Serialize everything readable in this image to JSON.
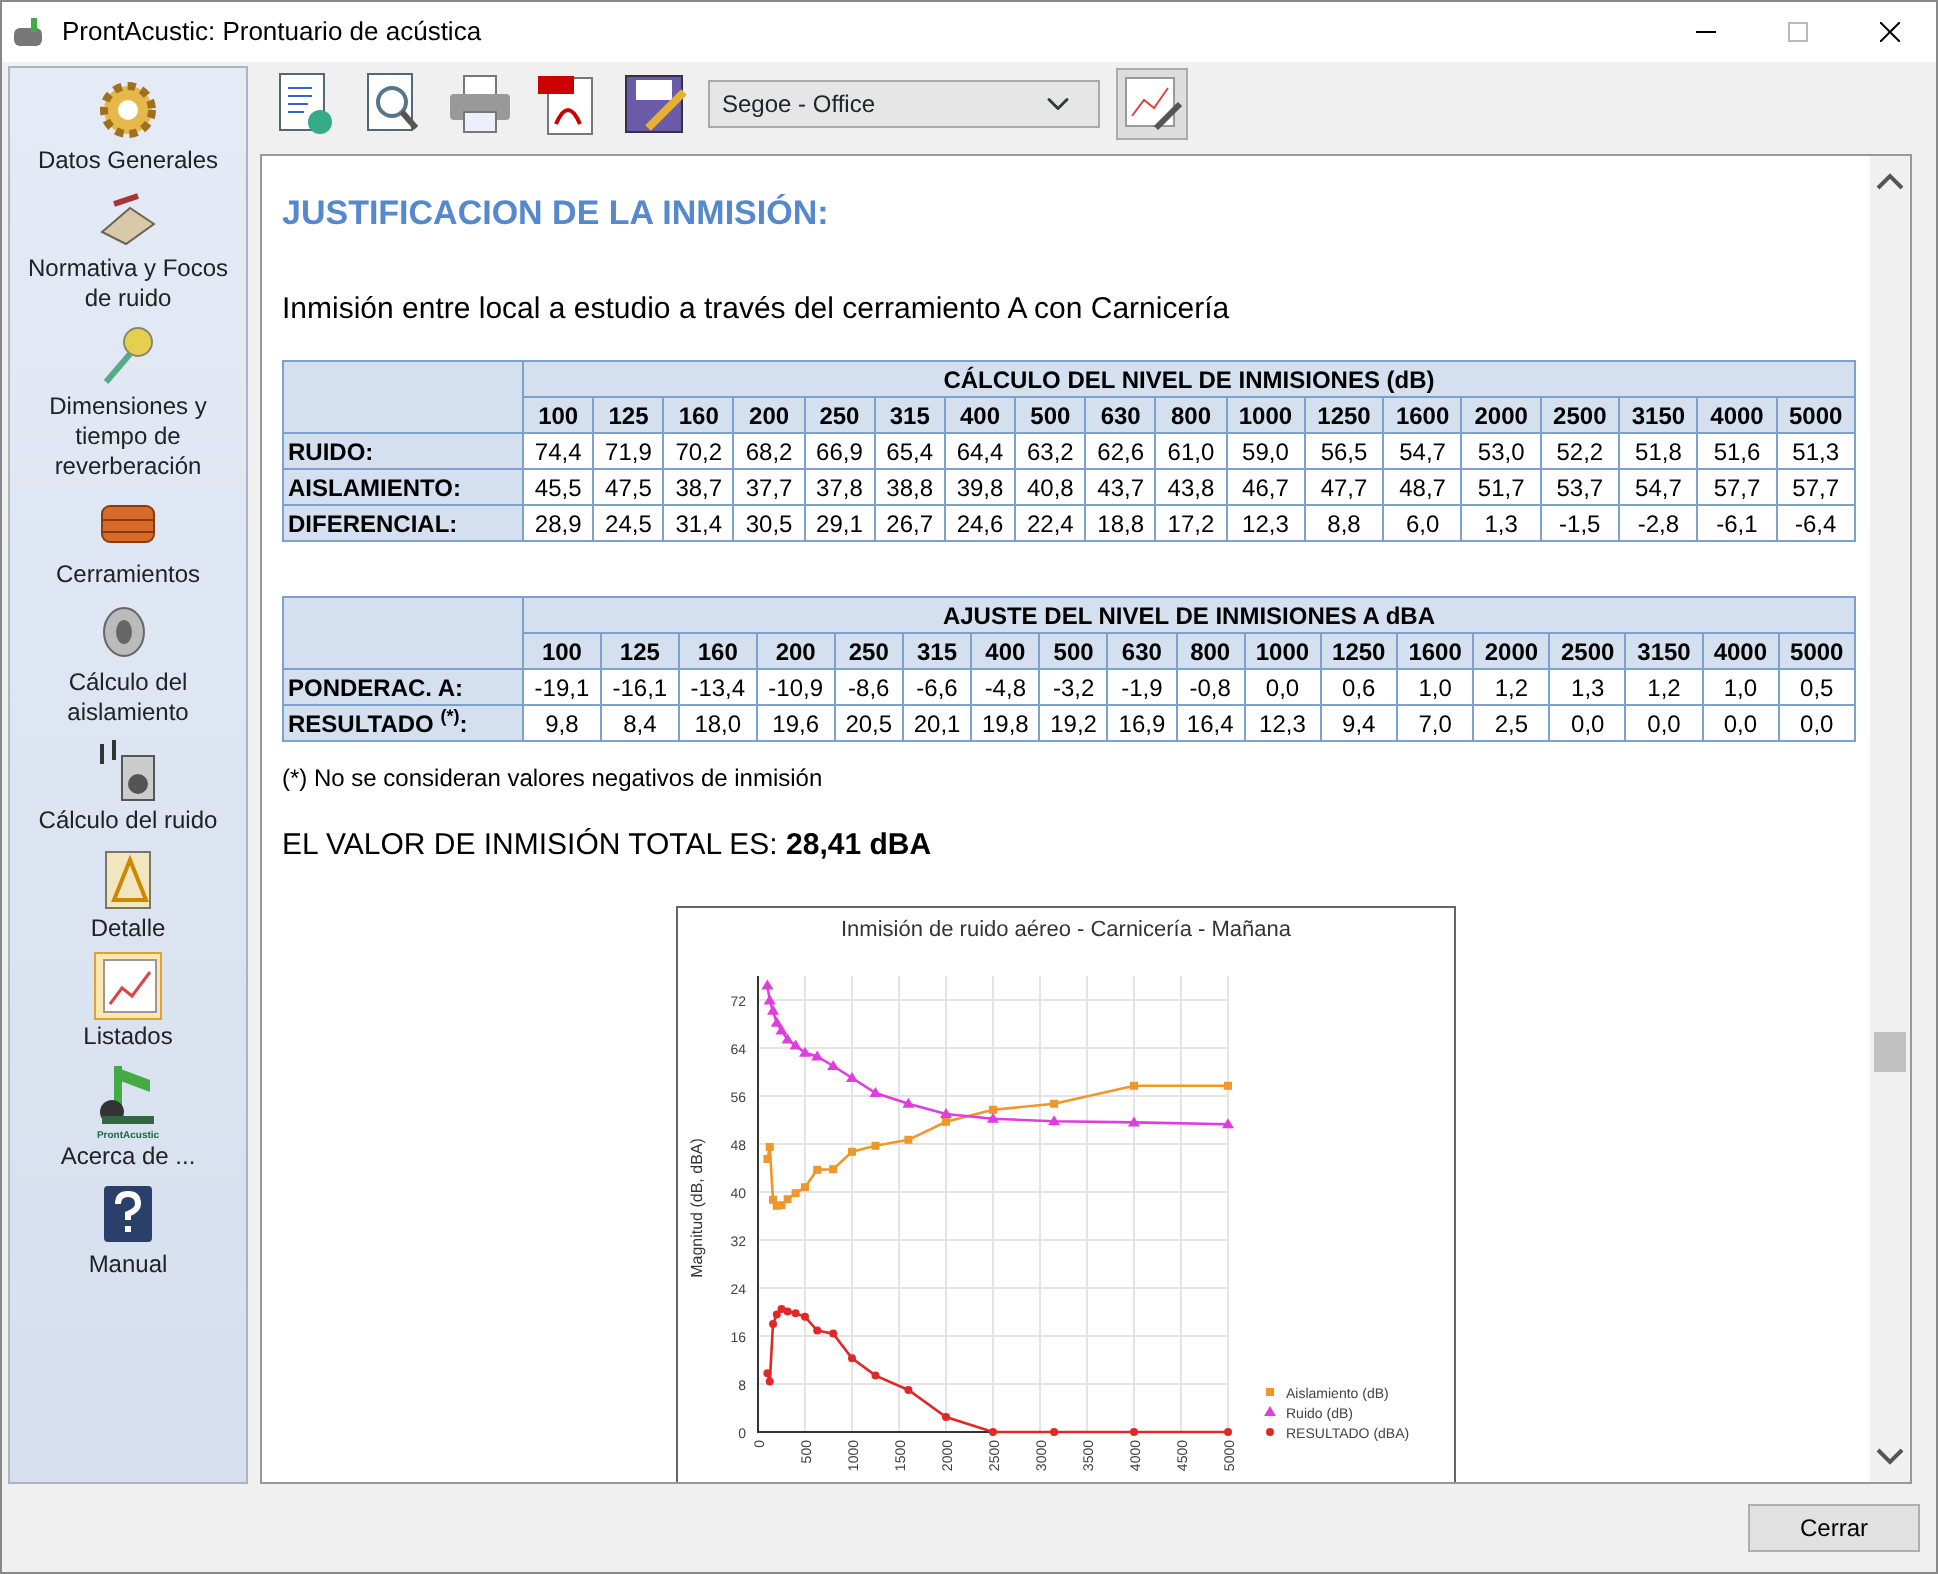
{
  "window": {
    "title": "ProntAcustic: Prontuario de acústica"
  },
  "sidebar": {
    "items": [
      {
        "label": "Datos Generales",
        "selected": false
      },
      {
        "label": "Normativa y Focos de ruido",
        "selected": false
      },
      {
        "label": "Dimensiones y tiempo de reverberación",
        "selected": false
      },
      {
        "label": "Cerramientos",
        "selected": false
      },
      {
        "label": "Cálculo del aislamiento",
        "selected": false
      },
      {
        "label": "Cálculo del ruido",
        "selected": false
      },
      {
        "label": "Detalle",
        "selected": false
      },
      {
        "label": "Listados",
        "selected": true
      },
      {
        "label": "Acerca de ...",
        "icon_text": "ProntAcustic",
        "selected": false
      },
      {
        "label": "Manual",
        "selected": false
      }
    ]
  },
  "toolbar": {
    "font_select": {
      "value": "Segoe - Office"
    }
  },
  "content": {
    "heading": "JUSTIFICACION DE LA INMISIÓN:",
    "subtitle": "Inmisión entre local a estudio a través del cerramiento A con Carnicería",
    "tables": [
      {
        "title": "CÁLCULO DEL NIVEL DE INMISIONES (dB)",
        "columns": [
          "100",
          "125",
          "160",
          "200",
          "250",
          "315",
          "400",
          "500",
          "630",
          "800",
          "1000",
          "1250",
          "1600",
          "2000",
          "2500",
          "3150",
          "4000",
          "5000"
        ],
        "rows": [
          {
            "label": "RUIDO:",
            "values": [
              "74,4",
              "71,9",
              "70,2",
              "68,2",
              "66,9",
              "65,4",
              "64,4",
              "63,2",
              "62,6",
              "61,0",
              "59,0",
              "56,5",
              "54,7",
              "53,0",
              "52,2",
              "51,8",
              "51,6",
              "51,3"
            ]
          },
          {
            "label": "AISLAMIENTO:",
            "values": [
              "45,5",
              "47,5",
              "38,7",
              "37,7",
              "37,8",
              "38,8",
              "39,8",
              "40,8",
              "43,7",
              "43,8",
              "46,7",
              "47,7",
              "48,7",
              "51,7",
              "53,7",
              "54,7",
              "57,7",
              "57,7"
            ]
          },
          {
            "label": "DIFERENCIAL:",
            "values": [
              "28,9",
              "24,5",
              "31,4",
              "30,5",
              "29,1",
              "26,7",
              "24,6",
              "22,4",
              "18,8",
              "17,2",
              "12,3",
              "8,8",
              "6,0",
              "1,3",
              "-1,5",
              "-2,8",
              "-6,1",
              "-6,4"
            ]
          }
        ]
      },
      {
        "title": "AJUSTE DEL NIVEL DE INMISIONES A dBA",
        "columns": [
          "100",
          "125",
          "160",
          "200",
          "250",
          "315",
          "400",
          "500",
          "630",
          "800",
          "1000",
          "1250",
          "1600",
          "2000",
          "2500",
          "3150",
          "4000",
          "5000"
        ],
        "rows": [
          {
            "label": "PONDERAC. A:",
            "values": [
              "-19,1",
              "-16,1",
              "-13,4",
              "-10,9",
              "-8,6",
              "-6,6",
              "-4,8",
              "-3,2",
              "-1,9",
              "-0,8",
              "0,0",
              "0,6",
              "1,0",
              "1,2",
              "1,3",
              "1,2",
              "1,0",
              "0,5"
            ]
          },
          {
            "label": "RESULTADO $^{(*)}$:",
            "values": [
              "9,8",
              "8,4",
              "18,0",
              "19,6",
              "20,5",
              "20,1",
              "19,8",
              "19,2",
              "16,9",
              "16,4",
              "12,3",
              "9,4",
              "7,0",
              "2,5",
              "0,0",
              "0,0",
              "0,0",
              "0,0"
            ]
          }
        ]
      }
    ],
    "note": "(*) No se consideran valores negativos de inmisión",
    "total": {
      "label": "EL VALOR DE INMISIÓN TOTAL ES:",
      "value": "28,41 dBA"
    },
    "chart_data": {
      "type": "line",
      "title": "Inmisión de ruido aéreo - Carnicería - Mañana",
      "ylabel": "Magnitud (dB, dBA)",
      "x": [
        100,
        125,
        160,
        200,
        250,
        315,
        400,
        500,
        630,
        800,
        1000,
        1250,
        1600,
        2000,
        2500,
        3150,
        4000,
        5000
      ],
      "series": [
        {
          "name": "Aislamiento (dB)",
          "color": "#f0962a",
          "marker": "square",
          "values": [
            45.5,
            47.5,
            38.7,
            37.7,
            37.8,
            38.8,
            39.8,
            40.8,
            43.7,
            43.8,
            46.7,
            47.7,
            48.7,
            51.7,
            53.7,
            54.7,
            57.7,
            57.7
          ]
        },
        {
          "name": "Ruido (dB)",
          "color": "#e03ce0",
          "marker": "triangle",
          "values": [
            74.4,
            71.9,
            70.2,
            68.2,
            66.9,
            65.4,
            64.4,
            63.2,
            62.6,
            61.0,
            59.0,
            56.5,
            54.7,
            53.0,
            52.2,
            51.8,
            51.6,
            51.3
          ]
        },
        {
          "name": "RESULTADO (dBA)",
          "color": "#e02828",
          "marker": "circle",
          "values": [
            9.8,
            8.4,
            18.0,
            19.6,
            20.5,
            20.1,
            19.8,
            19.2,
            16.9,
            16.4,
            12.3,
            9.4,
            7.0,
            2.5,
            0.0,
            0.0,
            0.0,
            0.0
          ]
        }
      ],
      "grid": true,
      "legend": true,
      "xlim": [
        0,
        5000
      ],
      "ylim": [
        0,
        76
      ],
      "xticks": [
        {
          "value": 0,
          "label": "0"
        },
        {
          "value": 500,
          "label": "500"
        },
        {
          "value": 1000,
          "label": "1000"
        },
        {
          "value": 1500,
          "label": "1500"
        },
        {
          "value": 2000,
          "label": "2000"
        },
        {
          "value": 2500,
          "label": "2500"
        },
        {
          "value": 3000,
          "label": "3000"
        },
        {
          "value": 3500,
          "label": "3500"
        },
        {
          "value": 4000,
          "label": "4000"
        },
        {
          "value": 4500,
          "label": "4500"
        },
        {
          "value": 5000,
          "label": "5000"
        }
      ],
      "yticks": [
        0,
        8,
        16,
        24,
        32,
        40,
        48,
        56,
        64,
        72
      ]
    }
  },
  "footer": {
    "button": "Cerrar"
  }
}
